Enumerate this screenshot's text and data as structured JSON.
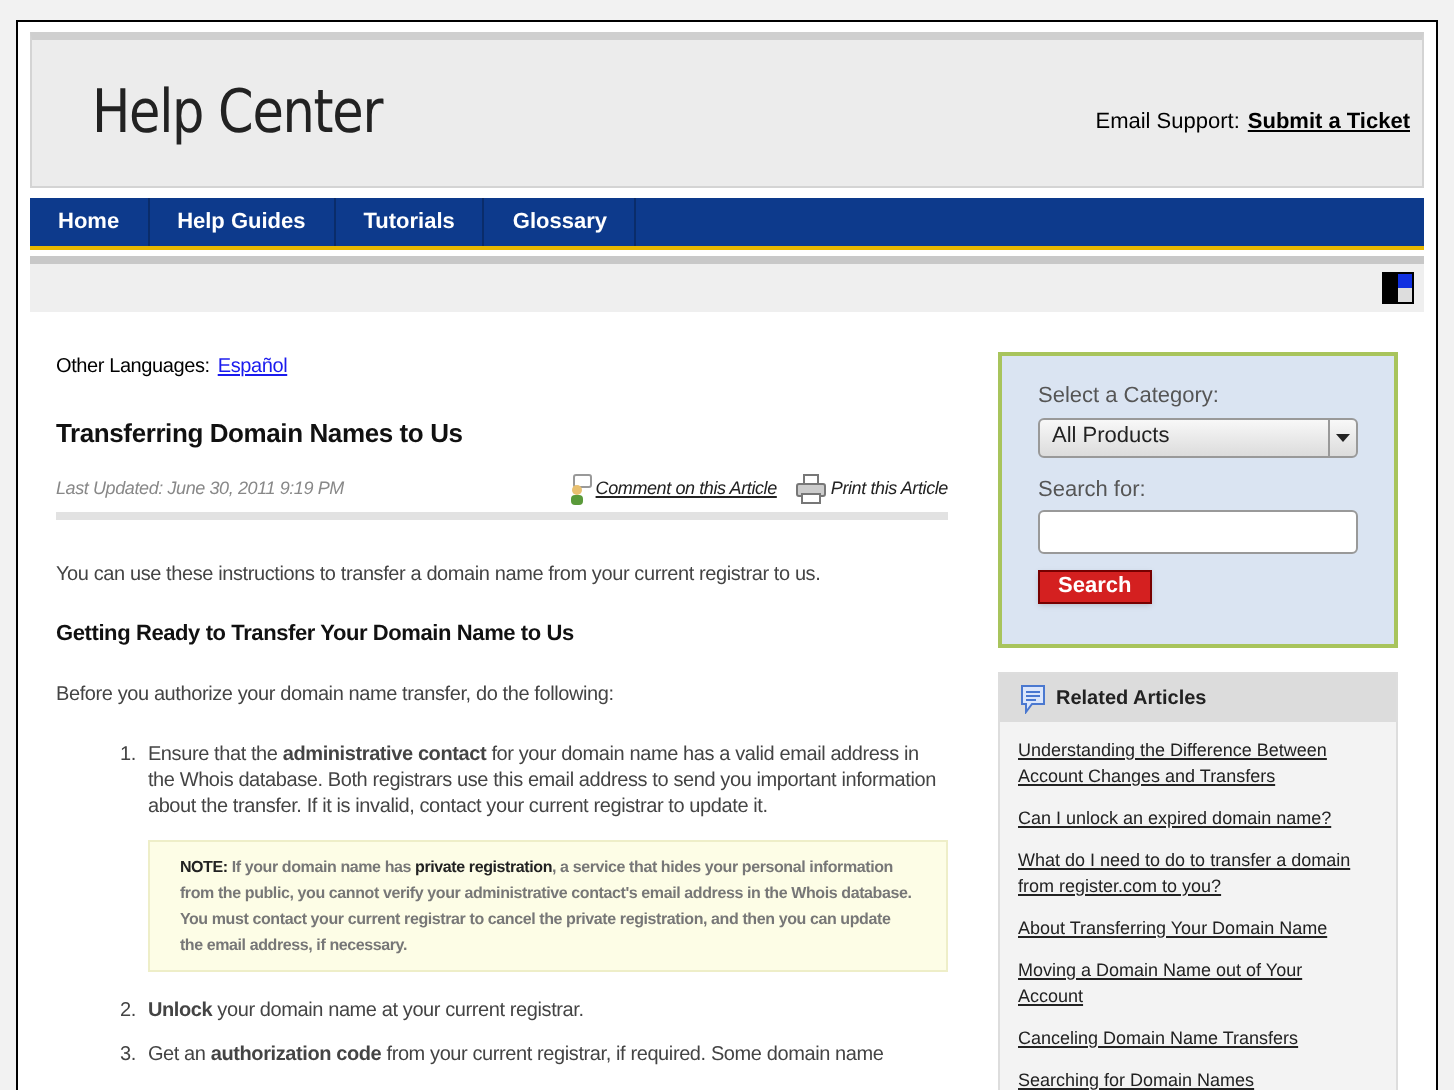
{
  "header": {
    "title": "Help Center",
    "support_label": "Email Support:",
    "support_link": "Submit a Ticket"
  },
  "nav": [
    "Home",
    "Help Guides",
    "Tutorials",
    "Glossary"
  ],
  "languages": {
    "label": "Other Languages:",
    "link": "Español"
  },
  "article": {
    "title": "Transferring Domain Names to Us",
    "updated": "Last Updated: June 30, 2011 9:19 PM",
    "comment_link": "Comment on this Article",
    "print_link": "Print this Article",
    "intro": "You can use these instructions to transfer a domain name from your current registrar to us.",
    "heading": "Getting Ready to Transfer Your Domain Name to Us",
    "lead": "Before you authorize your domain name transfer, do the following:",
    "steps": [
      {
        "number": "1.",
        "text": "Ensure that the **administrative contact** for your domain name has a valid email address in the Whois database. Both registrars use this email address to send you important information about the transfer. If it is invalid, contact your current registrar to update it.",
        "note": "**NOTE:** If your domain name has **private registration**, a service that hides your personal information from the public, you cannot verify your administrative contact's email address in the Whois database. You must contact your current registrar to cancel the private registration, and then you can update the email address, if necessary."
      },
      {
        "number": "2.",
        "text": "**Unlock** your domain name at your current registrar."
      },
      {
        "number": "3.",
        "text": "Get an **authorization code** from your current registrar, if required. Some domain name"
      }
    ]
  },
  "search_box": {
    "category_label": "Select a Category:",
    "category_value": "All Products",
    "search_label": "Search for:",
    "button": "Search"
  },
  "related": {
    "title": "Related Articles",
    "links": [
      "Understanding the Difference Between Account Changes and Transfers",
      "Can I unlock an expired domain name?",
      "What do I need to do to transfer a domain from register.com to you?",
      "About Transferring Your Domain Name",
      "Moving a Domain Name out of Your Account",
      "Canceling Domain Name Transfers",
      "Searching for Domain Names"
    ]
  }
}
